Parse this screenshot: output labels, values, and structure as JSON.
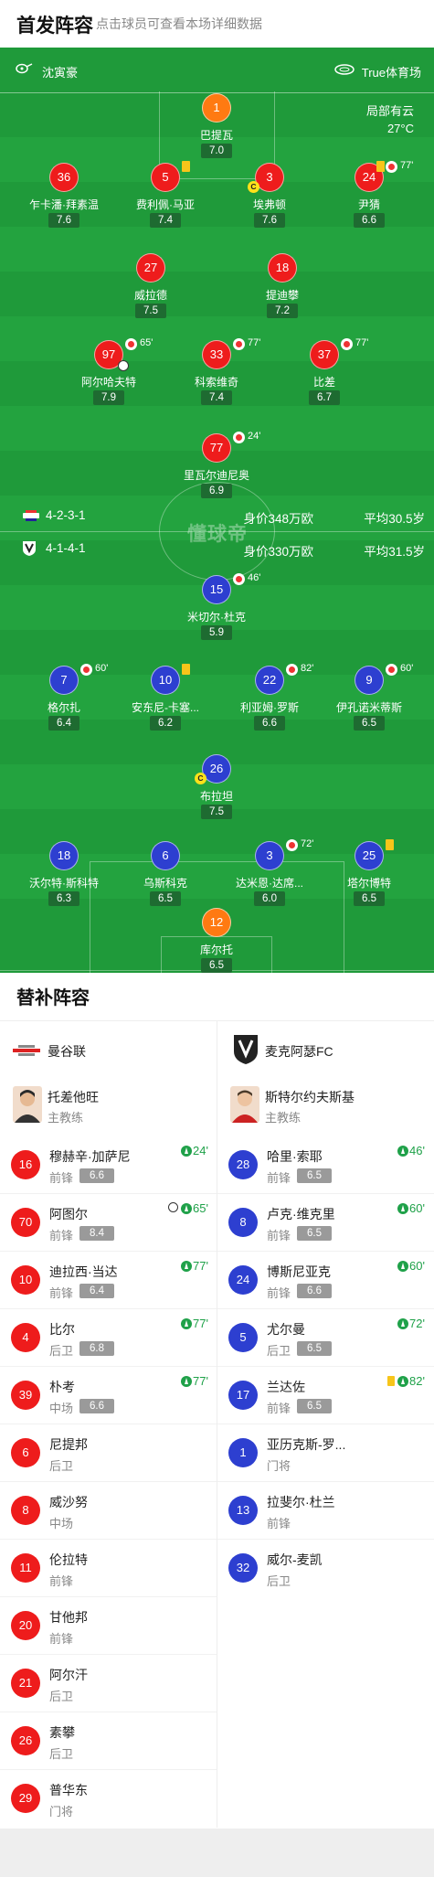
{
  "header": {
    "title": "首发阵容",
    "hint": "点击球员可查看本场详细数据"
  },
  "match_info": {
    "referee": "沈寅豪",
    "venue": "True体育场",
    "weather": "局部有云",
    "temperature": "27°C"
  },
  "home_team": {
    "name": "曼谷联",
    "formation": "4-2-3-1",
    "value_label": "身价348万欧",
    "age_label": "平均30.5岁",
    "color": "#ee1c1c",
    "lineup": [
      {
        "number": "1",
        "name": "巴提瓦",
        "rating": "7.0"
      },
      {
        "number": "36",
        "name": "乍卡潘·拜素温",
        "rating": "7.6"
      },
      {
        "number": "5",
        "name": "费利佩·马亚",
        "rating": "7.4"
      },
      {
        "number": "3",
        "name": "埃弗顿",
        "rating": "7.6"
      },
      {
        "number": "24",
        "name": "尹猜",
        "rating": "6.6",
        "sub_min": "77'"
      },
      {
        "number": "27",
        "name": "威拉德",
        "rating": "7.5"
      },
      {
        "number": "18",
        "name": "提迪攀",
        "rating": "7.2"
      },
      {
        "number": "97",
        "name": "阿尔哈夫特",
        "rating": "7.9",
        "sub_min": "65'"
      },
      {
        "number": "33",
        "name": "科索维奇",
        "rating": "7.4",
        "sub_min": "77'"
      },
      {
        "number": "37",
        "name": "比差",
        "rating": "6.7",
        "sub_min": "77'"
      },
      {
        "number": "77",
        "name": "里瓦尔迪尼奥",
        "rating": "6.9",
        "sub_min": "24'"
      }
    ],
    "coach": {
      "name": "托差他旺",
      "role": "主教练"
    },
    "subs": [
      {
        "number": "16",
        "name": "穆赫辛·加萨尼",
        "position": "前锋",
        "rating": "6.6",
        "minute": "24'"
      },
      {
        "number": "70",
        "name": "阿图尔",
        "position": "前锋",
        "rating": "8.4",
        "minute": "65'"
      },
      {
        "number": "10",
        "name": "迪拉西·当达",
        "position": "前锋",
        "rating": "6.4",
        "minute": "77'"
      },
      {
        "number": "4",
        "name": "比尔",
        "position": "后卫",
        "rating": "6.8",
        "minute": "77'"
      },
      {
        "number": "39",
        "name": "朴考",
        "position": "中场",
        "rating": "6.6",
        "minute": "77'"
      },
      {
        "number": "6",
        "name": "尼提邦",
        "position": "后卫"
      },
      {
        "number": "8",
        "name": "威沙努",
        "position": "中场"
      },
      {
        "number": "11",
        "name": "伦拉特",
        "position": "前锋"
      },
      {
        "number": "20",
        "name": "甘他邦",
        "position": "前锋"
      },
      {
        "number": "21",
        "name": "阿尔汗",
        "position": "后卫"
      },
      {
        "number": "26",
        "name": "素攀",
        "position": "后卫"
      },
      {
        "number": "29",
        "name": "普华东",
        "position": "门将"
      }
    ]
  },
  "away_team": {
    "name": "麦克阿瑟FC",
    "formation": "4-1-4-1",
    "value_label": "身价330万欧",
    "age_label": "平均31.5岁",
    "color": "#2d3fd0",
    "lineup": [
      {
        "number": "15",
        "name": "米切尔·杜克",
        "rating": "5.9",
        "sub_min": "46'"
      },
      {
        "number": "7",
        "name": "格尔扎",
        "rating": "6.4",
        "sub_min": "60'"
      },
      {
        "number": "10",
        "name": "安东尼-卡塞...",
        "rating": "6.2"
      },
      {
        "number": "22",
        "name": "利亚姆·罗斯",
        "rating": "6.6",
        "sub_min": "82'"
      },
      {
        "number": "9",
        "name": "伊孔诺米蒂斯",
        "rating": "6.5",
        "sub_min": "60'"
      },
      {
        "number": "26",
        "name": "布拉坦",
        "rating": "7.5"
      },
      {
        "number": "18",
        "name": "沃尔特·斯科特",
        "rating": "6.3"
      },
      {
        "number": "6",
        "name": "乌斯科克",
        "rating": "6.5"
      },
      {
        "number": "3",
        "name": "达米恩·达席...",
        "rating": "6.0",
        "sub_min": "72'"
      },
      {
        "number": "25",
        "name": "塔尔博特",
        "rating": "6.5"
      },
      {
        "number": "12",
        "name": "库尔托",
        "rating": "6.5"
      }
    ],
    "coach": {
      "name": "斯特尔约夫斯基",
      "role": "主教练"
    },
    "subs": [
      {
        "number": "28",
        "name": "哈里·索耶",
        "position": "前锋",
        "rating": "6.5",
        "minute": "46'"
      },
      {
        "number": "8",
        "name": "卢克·维克里",
        "position": "前锋",
        "rating": "6.5",
        "minute": "60'"
      },
      {
        "number": "24",
        "name": "博斯尼亚克",
        "position": "前锋",
        "rating": "6.6",
        "minute": "60'"
      },
      {
        "number": "5",
        "name": "尤尔曼",
        "position": "后卫",
        "rating": "6.5",
        "minute": "72'"
      },
      {
        "number": "17",
        "name": "兰达佐",
        "position": "前锋",
        "rating": "6.5",
        "minute": "82'"
      },
      {
        "number": "1",
        "name": "亚历克斯-罗...",
        "position": "门将"
      },
      {
        "number": "13",
        "name": "拉斐尔·杜兰",
        "position": "前锋"
      },
      {
        "number": "32",
        "name": "威尔-麦凯",
        "position": "后卫"
      }
    ]
  },
  "pitch": {
    "watermark": "懂球帝",
    "captain_mark": "C"
  },
  "substitutes_section": {
    "title": "替补阵容"
  }
}
